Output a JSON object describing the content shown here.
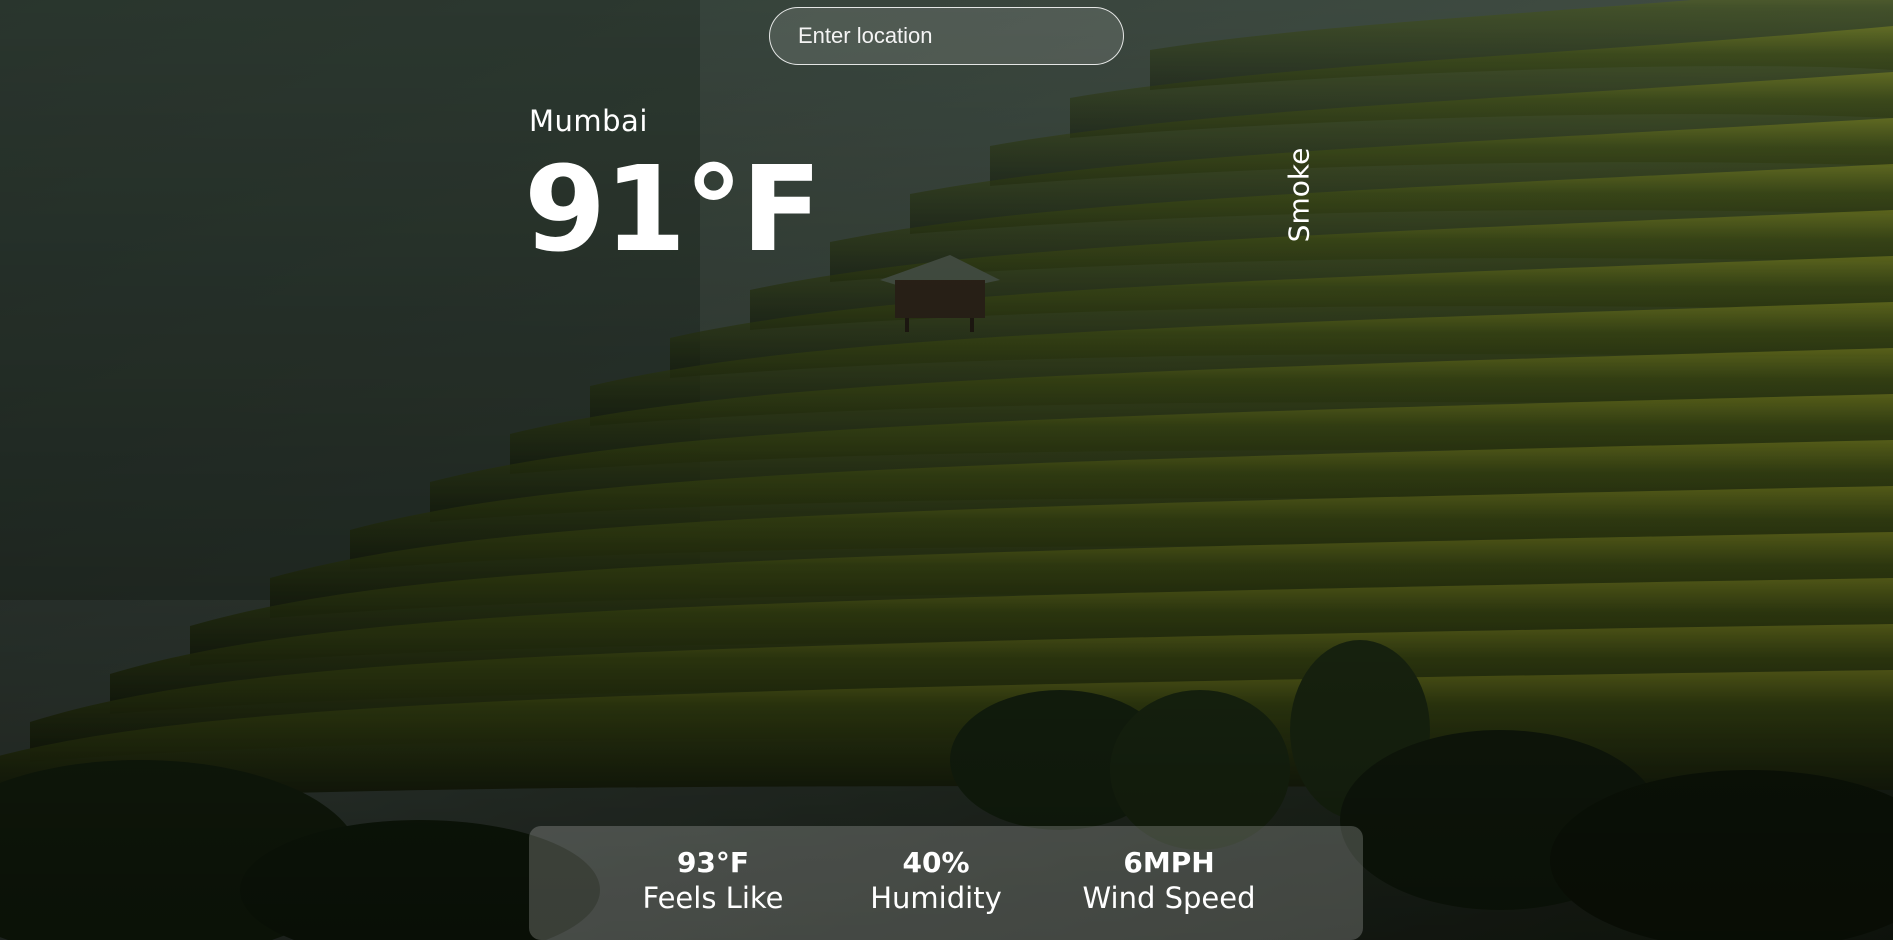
{
  "search": {
    "placeholder": "Enter location"
  },
  "weather": {
    "city": "Mumbai",
    "temperature": "91°F",
    "condition": "Smoke"
  },
  "stats": [
    {
      "value": "93°F",
      "label": "Feels Like"
    },
    {
      "value": "40%",
      "label": "Humidity"
    },
    {
      "value": "6MPH",
      "label": "Wind Speed"
    }
  ],
  "background": {
    "description_icon": "rice-terraces-landscape-image",
    "colors": {
      "sky": "#3b4a3e",
      "terrace_light": "#8a9a2a",
      "terrace_dark": "#1e2b12"
    }
  }
}
